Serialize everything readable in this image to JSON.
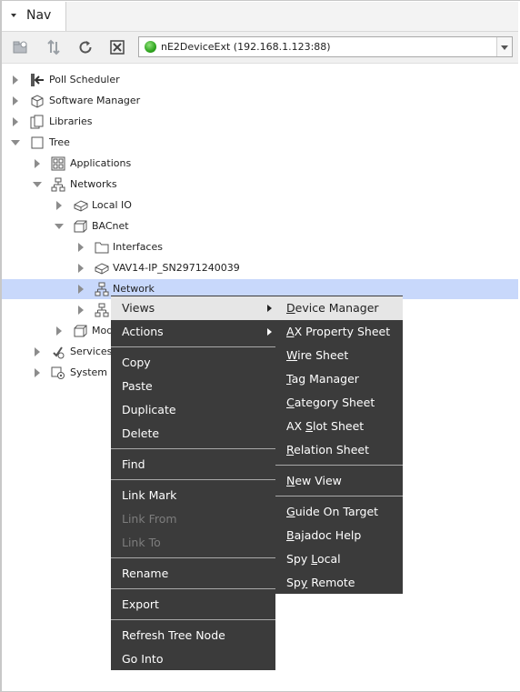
{
  "nav": {
    "title": "Nav"
  },
  "toolbar": {
    "station": "nE2DeviceExt (192.168.1.123:88)",
    "buttons": [
      "new-station-icon",
      "sort-icon",
      "refresh-icon",
      "close-icon"
    ]
  },
  "tree": [
    {
      "label": "Poll Scheduler",
      "icon": "poll-scheduler-icon"
    },
    {
      "label": "Software Manager",
      "icon": "software-manager-icon"
    },
    {
      "label": "Libraries",
      "icon": "libraries-icon"
    },
    {
      "label": "Tree",
      "icon": "tree-icon"
    },
    {
      "label": "Applications",
      "icon": "applications-icon"
    },
    {
      "label": "Networks",
      "icon": "network-icon"
    },
    {
      "label": "Local IO",
      "icon": "local-io-icon"
    },
    {
      "label": "BACnet",
      "icon": "bacnet-icon"
    },
    {
      "label": "Interfaces",
      "icon": "folder-icon"
    },
    {
      "label": "VAV14-IP_SN2971240039",
      "icon": "device-icon"
    },
    {
      "label": "Network",
      "icon": "network-icon"
    },
    {
      "label": "",
      "icon": "network-icon"
    },
    {
      "label": "Mod",
      "icon": "module-icon"
    },
    {
      "label": "Services",
      "icon": "services-icon"
    },
    {
      "label": "System",
      "icon": "system-icon"
    }
  ],
  "context_menu": {
    "items": [
      "Views",
      "Actions",
      "Copy",
      "Paste",
      "Duplicate",
      "Delete",
      "Find",
      "Link Mark",
      "Link From",
      "Link To",
      "Rename",
      "Export",
      "Refresh Tree Node",
      "Go Into"
    ]
  },
  "views_submenu": {
    "items": [
      {
        "pre": "",
        "key": "D",
        "post": "evice Manager"
      },
      {
        "pre": "",
        "key": "A",
        "post": "X Property Sheet"
      },
      {
        "pre": "",
        "key": "W",
        "post": "ire Sheet"
      },
      {
        "pre": "",
        "key": "T",
        "post": "ag Manager"
      },
      {
        "pre": "",
        "key": "C",
        "post": "ategory Sheet"
      },
      {
        "pre": "AX ",
        "key": "S",
        "post": "lot Sheet"
      },
      {
        "pre": "",
        "key": "R",
        "post": "elation Sheet"
      },
      {
        "pre": "",
        "key": "N",
        "post": "ew View"
      },
      {
        "pre": "",
        "key": "G",
        "post": "uide On Target"
      },
      {
        "pre": "",
        "key": "B",
        "post": "ajadoc Help"
      },
      {
        "pre": "Spy ",
        "key": "L",
        "post": "ocal"
      },
      {
        "pre": "Sp",
        "key": "y",
        "post": " Remote"
      }
    ]
  }
}
